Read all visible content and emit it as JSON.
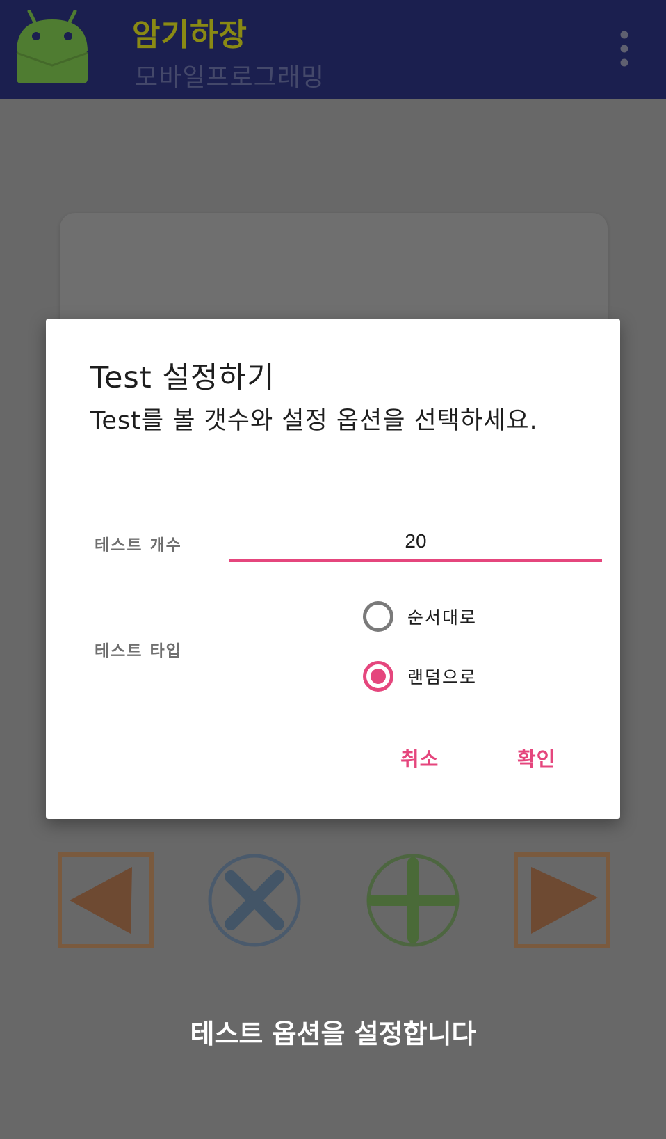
{
  "app": {
    "title": "암기하장",
    "subtitle": "모바일프로그래밍",
    "logo_icon": "android-robot-icon",
    "menu_icon": "more-vert-icon"
  },
  "dialog": {
    "title": "Test 설정하기",
    "message": "Test를 볼 갯수와 설정 옵션을 선택하세요.",
    "count_label": "테스트 개수",
    "count_value": "20",
    "type_label": "테스트 타입",
    "options": [
      {
        "label": "순서대로",
        "selected": false
      },
      {
        "label": "랜덤으로",
        "selected": true
      }
    ],
    "cancel_label": "취소",
    "ok_label": "확인"
  },
  "nav": {
    "prev_icon": "triangle-left-icon",
    "delete_icon": "x-circle-icon",
    "add_icon": "plus-circle-icon",
    "next_icon": "triangle-right-icon"
  },
  "caption": "테스트 옵션을 설정합니다",
  "colors": {
    "appbar": "#1b1f4f",
    "accent": "#e5467d",
    "scrim": "#686868"
  }
}
